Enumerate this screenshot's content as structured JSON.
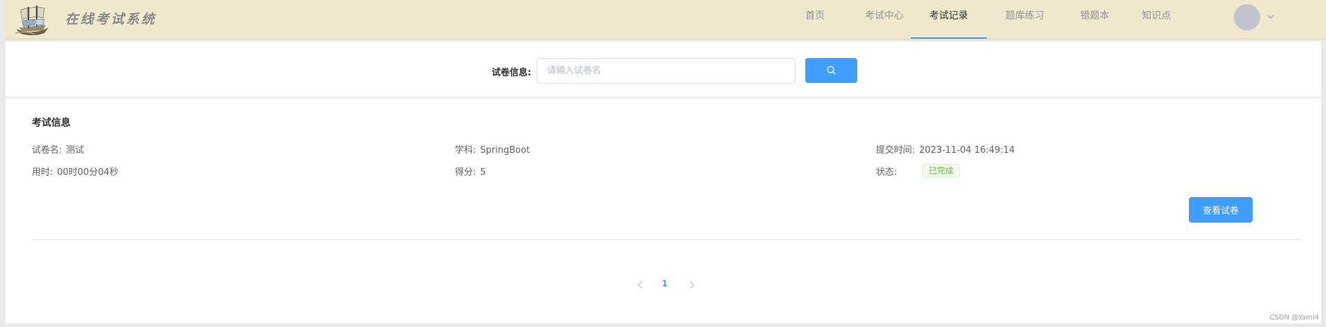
{
  "header": {
    "title": "在线考试系统",
    "nav": [
      {
        "label": "首页",
        "active": false
      },
      {
        "label": "考试中心",
        "active": false
      },
      {
        "label": "考试记录",
        "active": true
      },
      {
        "label": "题库练习",
        "active": false
      },
      {
        "label": "错题本",
        "active": false
      },
      {
        "label": "知识点",
        "active": false
      }
    ]
  },
  "search": {
    "label": "试卷信息:",
    "placeholder": "请输入试卷名",
    "value": ""
  },
  "record": {
    "section_title": "考试信息",
    "paper_name_label": "试卷名:",
    "paper_name": "测试",
    "subject_label": "学科:",
    "subject": "SpringBoot",
    "submit_time_label": "提交时间:",
    "submit_time": "2023-11-04 16:49:14",
    "duration_label": "用时:",
    "duration": "00时00分04秒",
    "score_label": "得分:",
    "score": "5",
    "status_label": "状态:",
    "status": "已完成",
    "view_button": "查看试卷"
  },
  "pagination": {
    "current_page": "1"
  },
  "watermark": "CSDN @Yaml4",
  "colors": {
    "header_bg": "#efe8cc",
    "primary": "#409eff",
    "success": "#67c23a"
  }
}
